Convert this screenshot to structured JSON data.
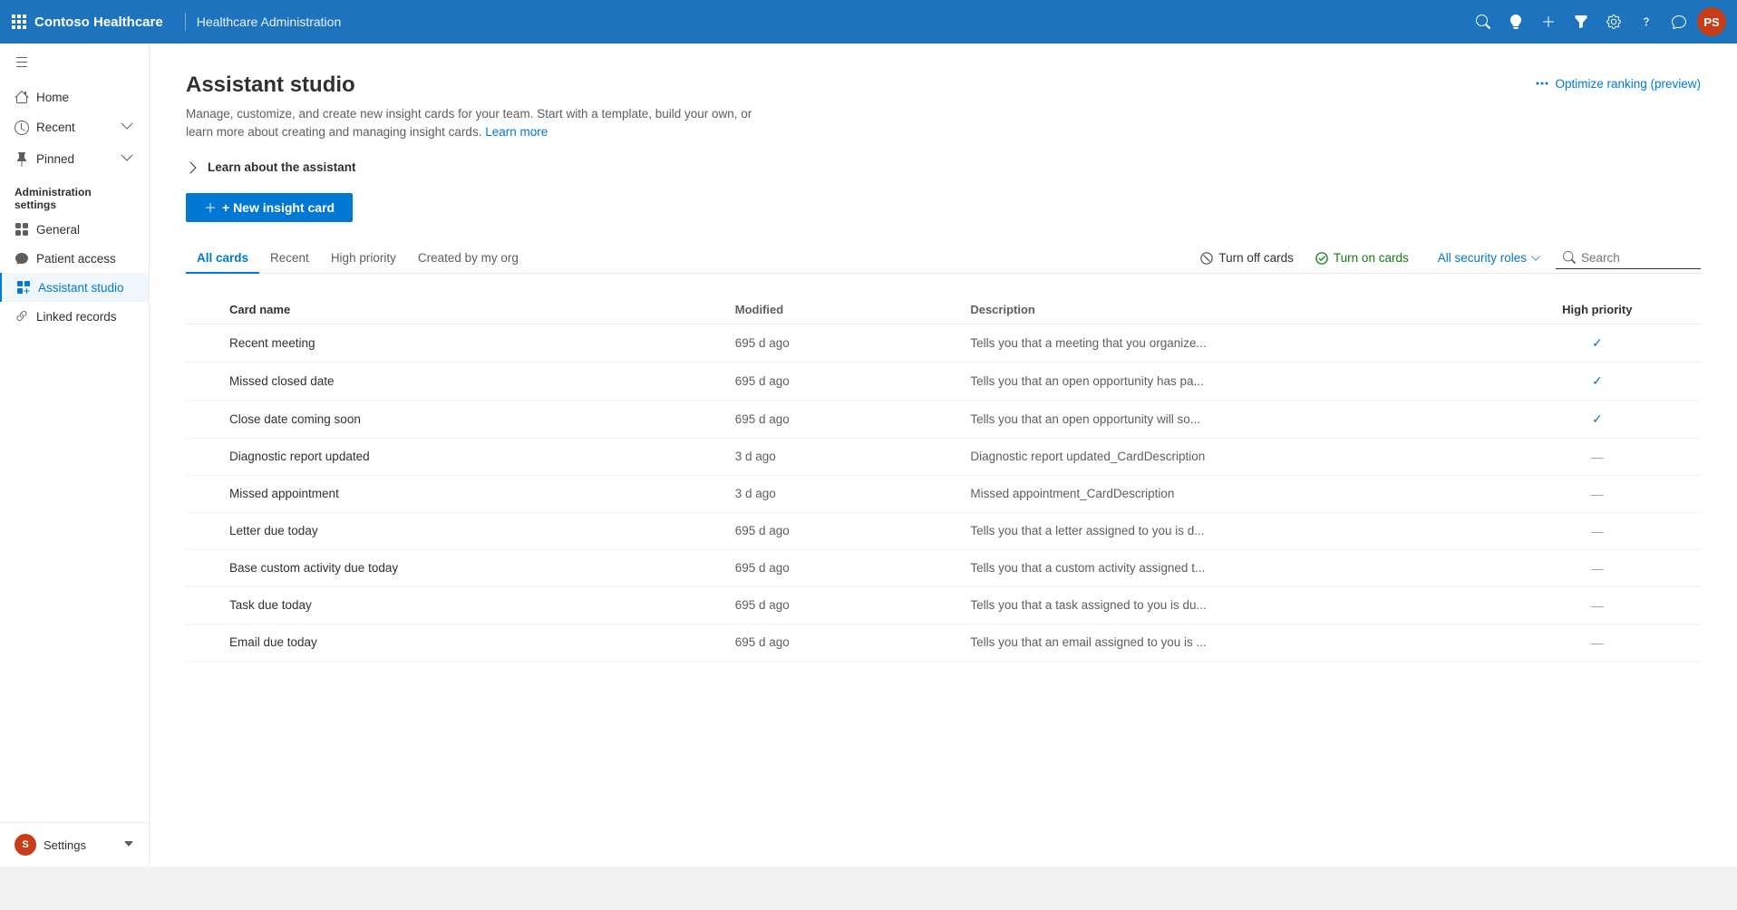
{
  "app": {
    "name": "Contoso Healthcare",
    "module": "Healthcare Administration",
    "avatar_initials": "PS"
  },
  "topbar": {
    "icons": [
      "search",
      "lightbulb",
      "plus",
      "filter",
      "settings",
      "help",
      "chat"
    ]
  },
  "sidebar": {
    "hamburger_label": "menu",
    "nav_items": [
      {
        "id": "home",
        "label": "Home",
        "icon": "home",
        "has_chevron": false,
        "active": false
      },
      {
        "id": "recent",
        "label": "Recent",
        "icon": "clock",
        "has_chevron": true,
        "active": false
      },
      {
        "id": "pinned",
        "label": "Pinned",
        "icon": "pin",
        "has_chevron": true,
        "active": false
      }
    ],
    "section_label": "Administration settings",
    "admin_items": [
      {
        "id": "general",
        "label": "General",
        "icon": "grid",
        "active": false
      },
      {
        "id": "patient-access",
        "label": "Patient access",
        "icon": "chat",
        "active": false
      },
      {
        "id": "assistant-studio",
        "label": "Assistant studio",
        "icon": "assistant",
        "active": true
      },
      {
        "id": "linked-records",
        "label": "Linked records",
        "icon": "link",
        "active": false
      }
    ],
    "bottom_label": "Settings",
    "bottom_avatar": "S"
  },
  "page": {
    "title": "Assistant studio",
    "subtitle": "Manage, customize, and create new insight cards for your team. Start with a template, build your own, or learn more about creating and managing insight cards.",
    "subtitle_link_text": "Learn more",
    "optimize_label": "Optimize ranking (preview)",
    "learn_label": "Learn about the assistant",
    "new_card_label": "+ New insight card"
  },
  "filters": {
    "tabs": [
      {
        "id": "all-cards",
        "label": "All cards",
        "active": true
      },
      {
        "id": "recent",
        "label": "Recent",
        "active": false
      },
      {
        "id": "high-priority",
        "label": "High priority",
        "active": false
      },
      {
        "id": "created-by-org",
        "label": "Created by my org",
        "active": false
      }
    ],
    "turn_off_label": "Turn off cards",
    "turn_on_label": "Turn on cards",
    "roles_label": "All security roles",
    "search_placeholder": "Search"
  },
  "table": {
    "columns": [
      "Card name",
      "Modified",
      "Description",
      "High priority"
    ],
    "rows": [
      {
        "name": "Recent meeting",
        "modified": "695 d ago",
        "description": "Tells you that a meeting that you organize...",
        "high_priority": "check"
      },
      {
        "name": "Missed closed date",
        "modified": "695 d ago",
        "description": "Tells you that an open opportunity has pa...",
        "high_priority": "check"
      },
      {
        "name": "Close date coming soon",
        "modified": "695 d ago",
        "description": "Tells you that an open opportunity will so...",
        "high_priority": "check"
      },
      {
        "name": "Diagnostic report updated",
        "modified": "3 d ago",
        "description": "Diagnostic report updated_CardDescription",
        "high_priority": "dash"
      },
      {
        "name": "Missed appointment",
        "modified": "3 d ago",
        "description": "Missed appointment_CardDescription",
        "high_priority": "dash"
      },
      {
        "name": "Letter due today",
        "modified": "695 d ago",
        "description": "Tells you that a letter assigned to you is d...",
        "high_priority": "dash"
      },
      {
        "name": "Base custom activity due today",
        "modified": "695 d ago",
        "description": "Tells you that a custom activity assigned t...",
        "high_priority": "dash"
      },
      {
        "name": "Task due today",
        "modified": "695 d ago",
        "description": "Tells you that a task assigned to you is du...",
        "high_priority": "dash"
      },
      {
        "name": "Email due today",
        "modified": "695 d ago",
        "description": "Tells you that an email assigned to you is ...",
        "high_priority": "dash"
      }
    ]
  }
}
